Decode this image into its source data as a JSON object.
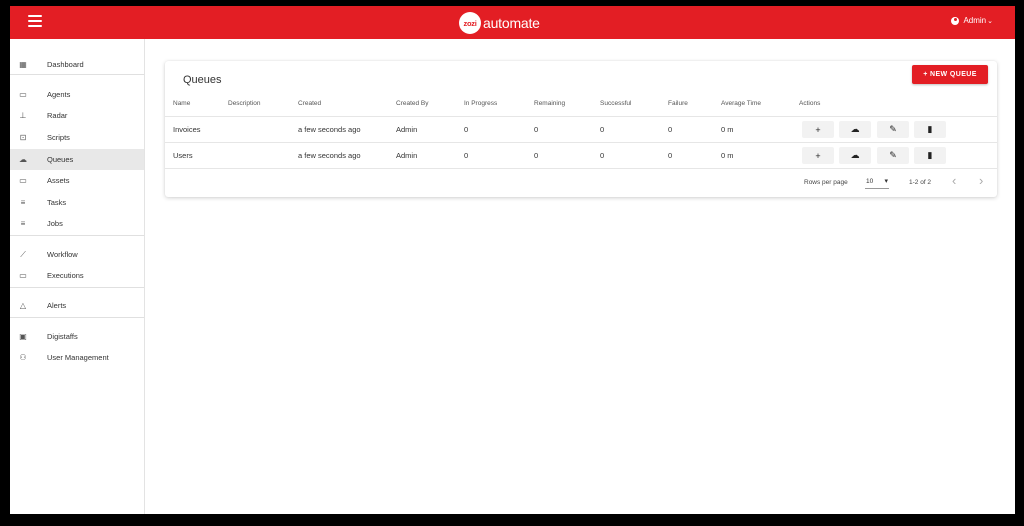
{
  "header": {
    "brand_mark": "zozi",
    "brand_name": "automate",
    "user_label": "Admin",
    "accent": "#e31e24"
  },
  "sidebar": {
    "items": [
      {
        "label": "Dashboard",
        "icon": "dashboard-icon"
      },
      {
        "label": "Agents",
        "icon": "laptop-icon"
      },
      {
        "label": "Radar",
        "icon": "radar-icon"
      },
      {
        "label": "Scripts",
        "icon": "scripts-icon"
      },
      {
        "label": "Queues",
        "icon": "cloud-icon",
        "active": true
      },
      {
        "label": "Assets",
        "icon": "assets-icon"
      },
      {
        "label": "Tasks",
        "icon": "tasks-icon"
      },
      {
        "label": "Jobs",
        "icon": "jobs-icon"
      },
      {
        "label": "Workflow",
        "icon": "workflow-icon"
      },
      {
        "label": "Executions",
        "icon": "executions-icon"
      },
      {
        "label": "Alerts",
        "icon": "bell-icon"
      },
      {
        "label": "Digistaffs",
        "icon": "robot-icon"
      },
      {
        "label": "User Management",
        "icon": "users-icon"
      }
    ]
  },
  "main": {
    "title": "Queues",
    "new_button": "+ NEW QUEUE",
    "columns": [
      "Name",
      "Description",
      "Created",
      "Created By",
      "In Progress",
      "Remaining",
      "Successful",
      "Failure",
      "Average Time",
      "Actions"
    ],
    "rows": [
      {
        "name": "Invoices",
        "description": "",
        "created": "a few seconds ago",
        "created_by": "Admin",
        "in_progress": "0",
        "remaining": "0",
        "successful": "0",
        "failure": "0",
        "average_time": "0 m"
      },
      {
        "name": "Users",
        "description": "",
        "created": "a few seconds ago",
        "created_by": "Admin",
        "in_progress": "0",
        "remaining": "0",
        "successful": "0",
        "failure": "0",
        "average_time": "0 m"
      }
    ],
    "actions": [
      "add-icon",
      "cloud-upload-icon",
      "edit-icon",
      "delete-icon"
    ],
    "pagination": {
      "rows_per_page_label": "Rows per page",
      "rows_per_page": "10",
      "range": "1-2 of 2"
    }
  }
}
